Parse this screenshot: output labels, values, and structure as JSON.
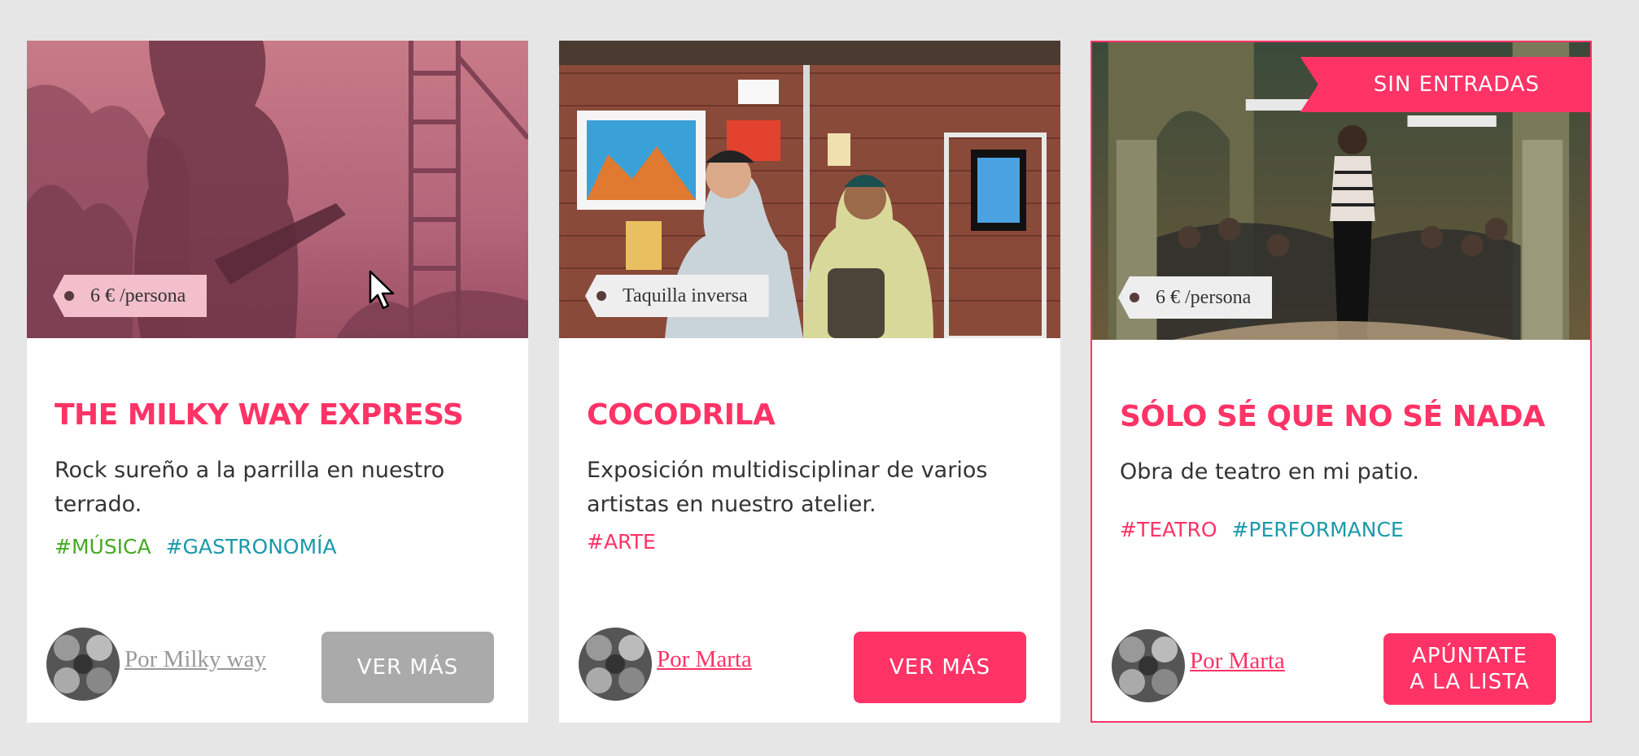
{
  "colors": {
    "background": "#e6e6e6",
    "accent": "#ff3366",
    "text": "#333333",
    "tag_green": "#44aa22",
    "tag_teal": "#1a9aaa",
    "tag_pink": "#ff3366",
    "button_disabled": "#aaaaaa"
  },
  "cards": [
    {
      "price": "6 € /persona",
      "title": "THE MILKY WAY EXPRESS",
      "description": "Rock sureño a la parrilla en nuestro terrado.",
      "tags": [
        {
          "label": "#MÚSICA",
          "color": "#44aa22"
        },
        {
          "label": "#GASTRONOMÍA",
          "color": "#1a9aaa"
        }
      ],
      "author": "Por Milky way",
      "author_color": "#999999",
      "button": "VER MÁS",
      "button_state": "disabled",
      "sold_out": ""
    },
    {
      "price": "Taquilla inversa",
      "title": "COCODRILA",
      "description": "Exposición multidisciplinar de varios artistas en nuestro atelier.",
      "tags": [
        {
          "label": "#ARTE",
          "color": "#ff3366"
        }
      ],
      "author": "Por Marta",
      "author_color": "#ff3366",
      "button": "VER MÁS",
      "button_state": "active",
      "sold_out": ""
    },
    {
      "price": "6 € /persona",
      "title": "SÓLO SÉ QUE NO SÉ NADA",
      "description": "Obra de teatro en mi patio.",
      "tags": [
        {
          "label": "#TEATRO",
          "color": "#ff3366"
        },
        {
          "label": "#PERFORMANCE",
          "color": "#1a9aaa"
        }
      ],
      "author": "Por Marta",
      "author_color": "#ff3366",
      "button": "APÚNTATE",
      "button_line2": "A LA LISTA",
      "button_state": "active",
      "sold_out": "SIN ENTRADAS"
    }
  ],
  "icons": {
    "cursor": "arrow-cursor-icon",
    "price": "tag-icon"
  }
}
